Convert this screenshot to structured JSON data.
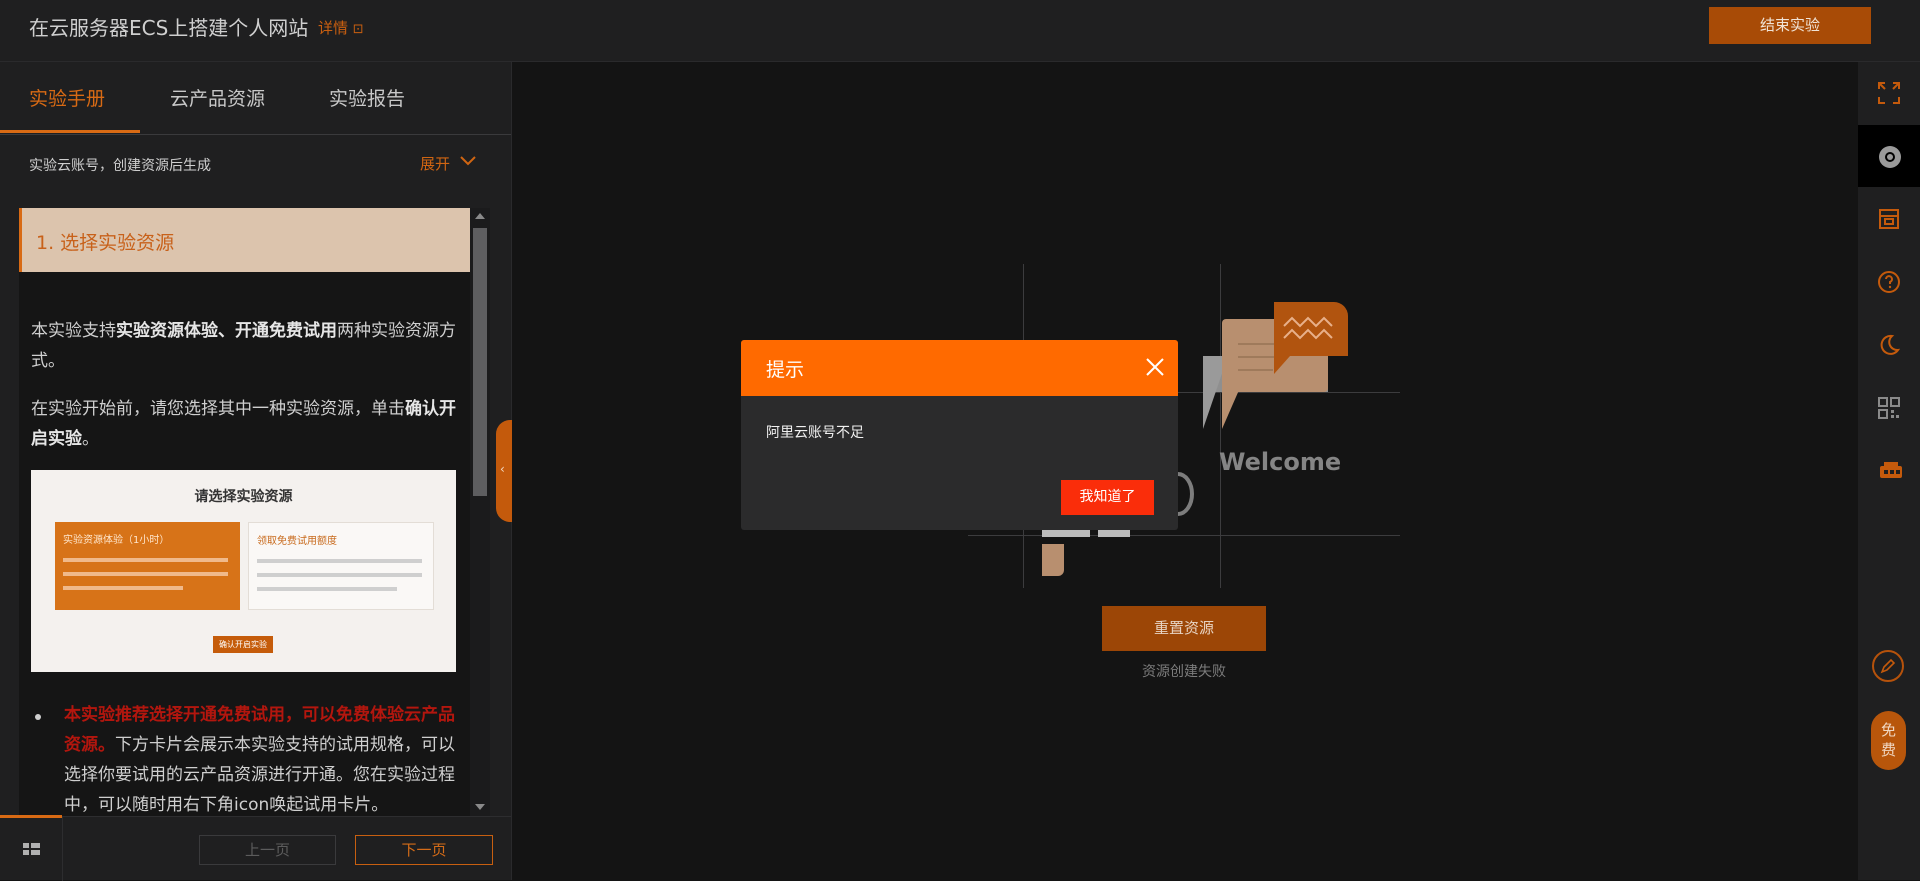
{
  "header": {
    "title": "在云服务器ECS上搭建个人网站",
    "detail_link": "详情",
    "end_button": "结束实验"
  },
  "tabs": [
    {
      "label": "实验手册"
    },
    {
      "label": "云产品资源"
    },
    {
      "label": "实验报告"
    }
  ],
  "account": {
    "label": "实验云账号，创建资源后生成",
    "expand": "展开"
  },
  "doc": {
    "step_title": "1. 选择实验资源",
    "p1_a": "本实验支持",
    "p1_b": "实验资源体验、开通免费试用",
    "p1_c": "两种实验资源方式。",
    "p2_a": "在实验开始前，请您选择其中一种实验资源，单击",
    "p2_b": "确认开启实验",
    "p2_c": "。",
    "screenshot": {
      "title": "请选择实验资源",
      "card1_title": "实验资源体验（1小时）",
      "card2_title": "领取免费试用额度",
      "confirm": "确认开启实验"
    },
    "bullet_red": "本实验推荐选择开通免费试用，可以免费体验云产品资源。",
    "bullet_rest": "下方卡片会展示本实验支持的试用规格，可以选择你要试用的云产品资源进行开通。您在实验过程中，可以随时用右下角icon唤起试用卡片。"
  },
  "footer": {
    "prev": "上一页",
    "next": "下一页"
  },
  "main": {
    "welcome": "Welcome",
    "reset_button": "重置资源",
    "status": "资源创建失败"
  },
  "sidebar_right": {
    "icons": [
      "fullscreen-icon",
      "browser-icon",
      "store-icon",
      "help-icon",
      "moon-icon",
      "qrcode-icon",
      "cart-icon",
      "edit-icon"
    ],
    "free_label": [
      "免",
      "费"
    ]
  },
  "modal": {
    "title": "提示",
    "message": "阿里云账号不足",
    "ok_button": "我知道了"
  },
  "colors": {
    "accent": "#ff6a00",
    "accent_dark": "#a84b06",
    "danger": "#fa2d0a"
  }
}
